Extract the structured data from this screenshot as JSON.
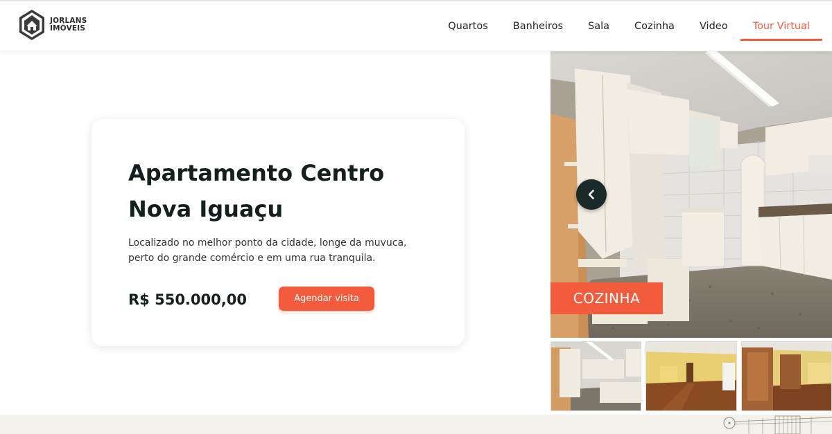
{
  "brand": {
    "line1": "JORLANS",
    "line2": "IMÓVEIS",
    "icon": "house-hexagon-logo"
  },
  "nav": {
    "items": [
      {
        "label": "Quartos",
        "active": false
      },
      {
        "label": "Banheiros",
        "active": false
      },
      {
        "label": "Sala",
        "active": false
      },
      {
        "label": "Cozinha",
        "active": false
      },
      {
        "label": "Video",
        "active": false
      },
      {
        "label": "Tour Virtual",
        "active": true
      }
    ]
  },
  "listing": {
    "title": "Apartamento Centro Nova Iguaçu",
    "description": "Localizado no melhor ponto da cidade, longe da muvuca, perto do grande comércio e em uma rua tranquila.",
    "price": "R$ 550.000,00",
    "cta_label": "Agendar visita"
  },
  "gallery": {
    "current_room": "COZINHA",
    "prev_icon": "chevron-left-icon",
    "thumbnails": [
      {
        "name": "kitchen-thumbnail"
      },
      {
        "name": "room-wood-floor-thumbnail"
      },
      {
        "name": "room-wardrobe-thumbnail"
      }
    ]
  },
  "colors": {
    "accent": "#f25c3d",
    "dark": "#14201e",
    "footer": "#f3f1ec"
  }
}
